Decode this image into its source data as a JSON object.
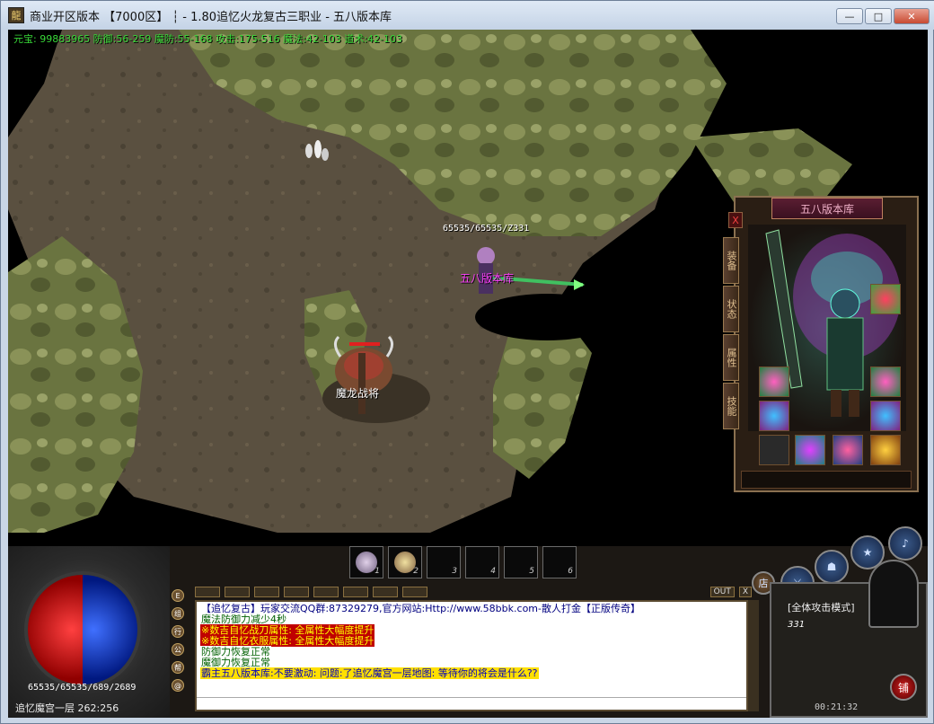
{
  "window": {
    "title": "商业开区版本 【7000区】 ┆ - 1.80追忆火龙复古三职业 - 五八版本库",
    "minimize": "—",
    "maximize": "□",
    "close": "✕"
  },
  "stats": {
    "line": "元宝: 99883965 防御:56-259 魔防:55-168 攻击:175-516 魔法:42-103 道术:42-103"
  },
  "player": {
    "hp_label": "65535/65535/Z331",
    "name": "五八版本库"
  },
  "monster": {
    "name": "魔龙战将"
  },
  "char_panel": {
    "title": "五八版本库",
    "close": "X",
    "tabs": [
      "装备",
      "状态",
      "属性",
      "技能"
    ]
  },
  "hotbar": {
    "slots": [
      "1",
      "2",
      "3",
      "4",
      "5",
      "6"
    ]
  },
  "chat_toolbar": {
    "out": "OUT",
    "close": "X"
  },
  "chat": {
    "lines": [
      {
        "text": "【追忆复古】玩家交流QQ群:87329279,官方网站:Http://www.58bbk.com-散人打金【正版传奇】",
        "color": "#000080",
        "bg": "#ffffff"
      },
      {
        "text": "魔法防御力减少4秒",
        "color": "#006000",
        "bg": "#ffffff"
      },
      {
        "text": "※数吉自忆战刀属性: 全属性大幅度提升",
        "color": "#ffff00",
        "bg": "#c00000"
      },
      {
        "text": "※数吉自忆衣服属性: 全属性大幅度提升",
        "color": "#ffff00",
        "bg": "#c00000"
      },
      {
        "text": "防御力恢复正常",
        "color": "#006000",
        "bg": "#ffffff"
      },
      {
        "text": "魔御力恢复正常",
        "color": "#006000",
        "bg": "#ffffff"
      },
      {
        "text": "霸主五八版本库:不要激动: 问题:了追忆魔宫一层地图: 等待你的将会是什么??",
        "color": "#0000c0",
        "bg": "#ffe000"
      }
    ]
  },
  "left_orb": {
    "hp_mp": "65535/65535/689/2689",
    "map": "追忆魔宫一层 262:256"
  },
  "side_icons": [
    "E",
    "组",
    "行",
    "公",
    "帮",
    "@"
  ],
  "right_panel": {
    "mode": "[全体攻击模式]",
    "level": "331",
    "time": "00:21:32",
    "shop_btn": "店",
    "shop2_btn": "铺"
  }
}
